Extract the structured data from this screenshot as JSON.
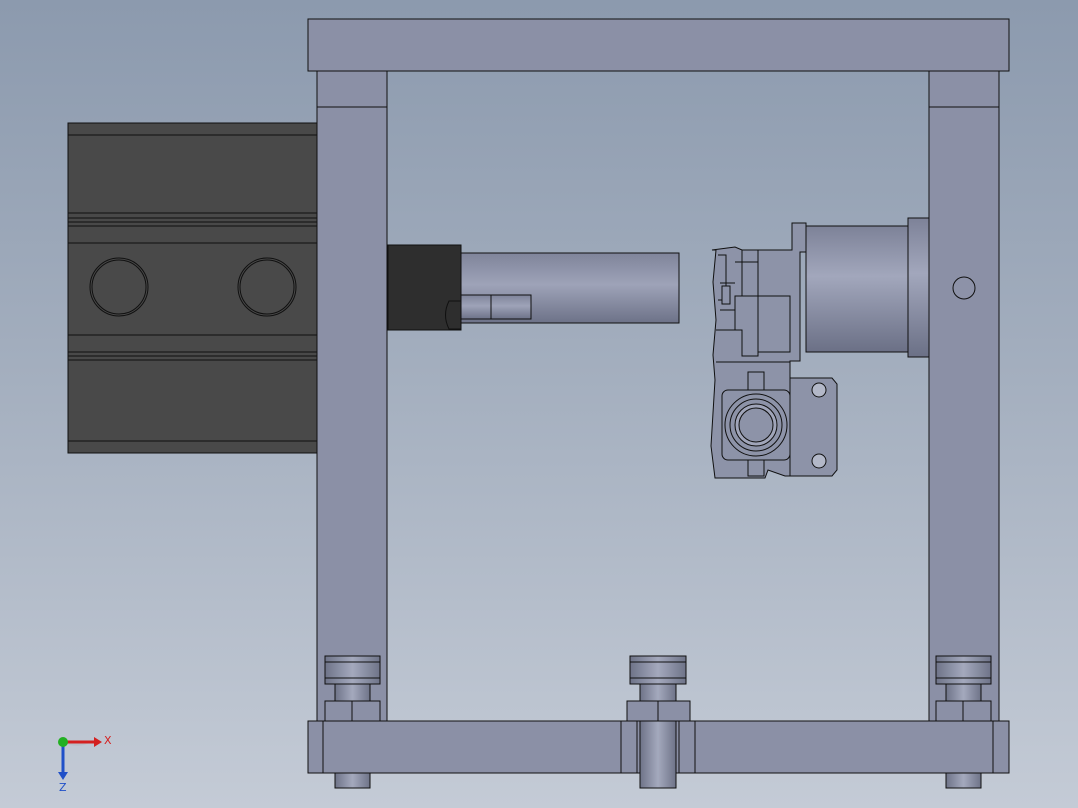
{
  "triad": {
    "x_label": "X",
    "z_label": "Z",
    "x_color": "#d42020",
    "y_color": "#22b022",
    "z_color": "#2050c8"
  },
  "colors": {
    "frame_fill": "#8b90a6",
    "frame_top": "#9a9fb3",
    "cylinder_fill": "#494949",
    "cylinder_dark": "#2d2d2d",
    "part_fill": "#8d93a8",
    "outline": "#101010"
  }
}
